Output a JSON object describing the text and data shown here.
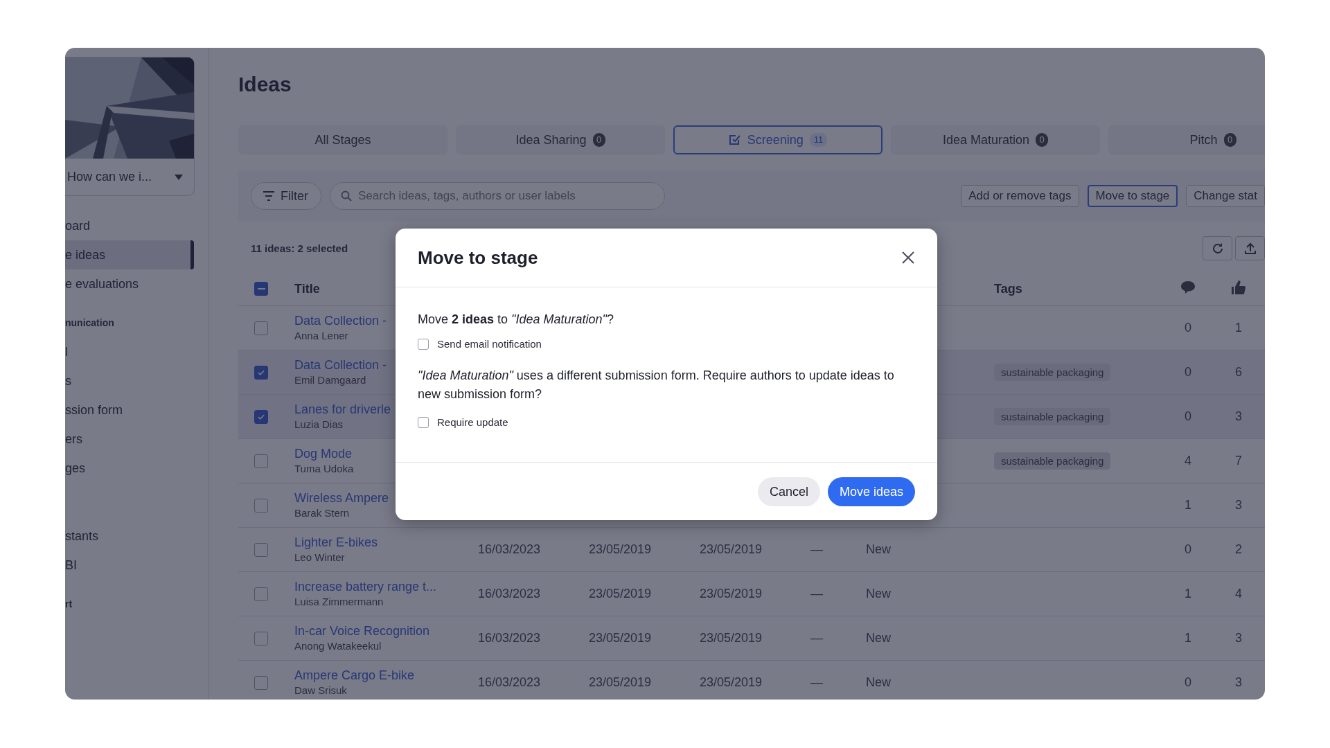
{
  "sidebar": {
    "project": {
      "title": "How can we i..."
    },
    "groups": [
      {
        "items": [
          {
            "label": "oard",
            "selected": false
          },
          {
            "label": "e ideas",
            "selected": true
          },
          {
            "label": "e evaluations",
            "selected": false
          }
        ]
      },
      {
        "heading": "nunication",
        "items": [
          {
            "label": "l",
            "selected": false
          },
          {
            "label": "s",
            "selected": false
          },
          {
            "label": "ssion form",
            "selected": false
          },
          {
            "label": "ers",
            "selected": false
          },
          {
            "label": "ges",
            "selected": false
          }
        ]
      },
      {
        "items": [
          {
            "label": "stants",
            "selected": false
          },
          {
            "label": "BI",
            "selected": false
          }
        ]
      },
      {
        "heading": "rt"
      }
    ]
  },
  "page": {
    "title": "Ideas"
  },
  "tabs": [
    {
      "label": "All Stages",
      "selected": false
    },
    {
      "label": "Idea Sharing",
      "count": "0",
      "selected": false
    },
    {
      "label": "Screening",
      "count": "11",
      "selected": true
    },
    {
      "label": "Idea Maturation",
      "count": "0",
      "selected": false
    },
    {
      "label": "Pitch",
      "count": "0",
      "selected": false
    }
  ],
  "toolbar": {
    "filter": "Filter",
    "search": {
      "placeholder": "Search ideas, tags, authors or user labels"
    },
    "actions": [
      {
        "label": "Add or remove tags",
        "selected": false
      },
      {
        "label": "Move to stage",
        "selected": true
      },
      {
        "label": "Change stat",
        "selected": false
      }
    ]
  },
  "table": {
    "summary": "11 ideas: 2 selected",
    "select_all": {
      "indeterminate": true
    },
    "columns": [
      "Title",
      "Tags"
    ],
    "rows": [
      {
        "title": "Data Collection -",
        "author": "Anna Lener",
        "selected": false,
        "comments": "0",
        "likes": "1"
      },
      {
        "title": "Data Collection -",
        "author": "Emil Damgaard",
        "selected": true,
        "tag": "sustainable packaging",
        "comments": "0",
        "likes": "6"
      },
      {
        "title": "Lanes for driverle",
        "author": "Luzia Dias",
        "selected": true,
        "tag": "sustainable packaging",
        "comments": "0",
        "likes": "3"
      },
      {
        "title": "Dog Mode",
        "author": "Tuma Udoka",
        "selected": false,
        "tag": "sustainable packaging",
        "comments": "4",
        "likes": "7"
      },
      {
        "title": "Wireless Ampere",
        "author": "Barak Stern",
        "selected": false,
        "comments": "1",
        "likes": "3"
      },
      {
        "title": "Lighter E-bikes",
        "author": "Leo Winter",
        "selected": false,
        "dates": [
          "16/03/2023",
          "23/05/2019",
          "23/05/2019"
        ],
        "dash": "—",
        "status": "New",
        "comments": "0",
        "likes": "2"
      },
      {
        "title": "Increase battery range t...",
        "author": "Luisa Zimmermann",
        "selected": false,
        "dates": [
          "16/03/2023",
          "23/05/2019",
          "23/05/2019"
        ],
        "dash": "—",
        "status": "New",
        "comments": "1",
        "likes": "4"
      },
      {
        "title": "In-car Voice Recognition",
        "author": "Anong Watakeekul",
        "selected": false,
        "dates": [
          "16/03/2023",
          "23/05/2019",
          "23/05/2019"
        ],
        "dash": "—",
        "status": "New",
        "comments": "1",
        "likes": "3"
      },
      {
        "title": "Ampere Cargo E-bike",
        "author": "Daw Srisuk",
        "selected": false,
        "dates": [
          "16/03/2023",
          "23/05/2019",
          "23/05/2019"
        ],
        "dash": "—",
        "status": "New",
        "comments": "0",
        "likes": "3"
      }
    ]
  },
  "modal": {
    "title": "Move to stage",
    "question": "Move **2 ideas** to *\"Idea Maturation\"*?",
    "options": [
      {
        "kind": "checkbox",
        "label": "Send email notification",
        "checked": false
      },
      {
        "kind": "text",
        "text": "*\"Idea Maturation\"* uses a different submission form. Require authors to update ideas to new submission form?"
      },
      {
        "kind": "checkbox",
        "label": "Require update",
        "checked": false
      }
    ],
    "buttons": [
      {
        "label": "Cancel",
        "kind": "secondary"
      },
      {
        "label": "Move ideas",
        "kind": "primary"
      }
    ]
  }
}
